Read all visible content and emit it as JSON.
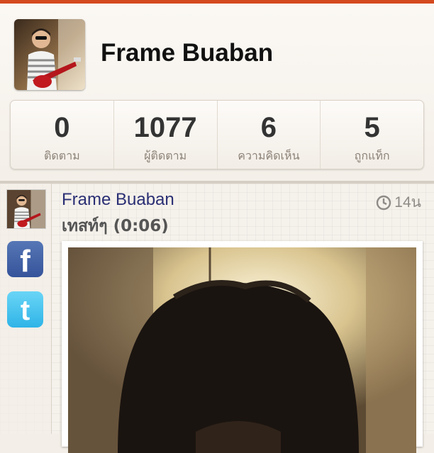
{
  "profile": {
    "name": "Frame Buaban"
  },
  "stats": [
    {
      "count": "0",
      "label": "ติดตาม"
    },
    {
      "count": "1077",
      "label": "ผู้ติดตาม"
    },
    {
      "count": "6",
      "label": "ความคิดเห็น"
    },
    {
      "count": "5",
      "label": "ถูกแท็ก"
    }
  ],
  "post": {
    "author": "Frame Buaban",
    "time": "14น",
    "caption": "เทสท์ๆ (0:06)"
  },
  "share": {
    "facebook_icon": "f",
    "twitter_icon": "t"
  },
  "colors": {
    "accent": "#d44a1f",
    "facebook": "#3b5998",
    "twitter": "#33b5e5",
    "author_link": "#2a2f74"
  }
}
